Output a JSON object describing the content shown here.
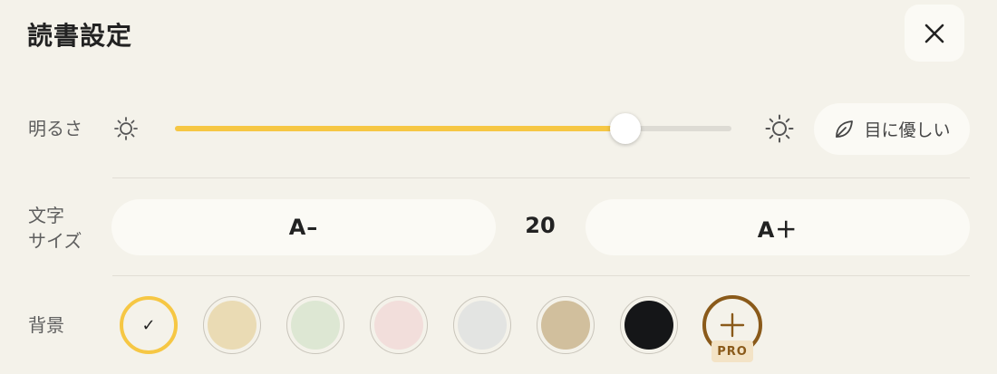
{
  "header": {
    "title": "読書設定",
    "close_icon": "close-icon"
  },
  "brightness": {
    "label": "明るさ",
    "level": 0.81,
    "low_icon": "sun-small-icon",
    "high_icon": "sun-large-icon",
    "accent_color": "#f6c744",
    "eye_friendly_label": "目に優しい",
    "eye_friendly_icon": "leaf-icon"
  },
  "font_size": {
    "label_line1": "文字",
    "label_line2": "サイズ",
    "decrease_label": "A–",
    "value": "20",
    "increase_label": "A＋"
  },
  "background": {
    "label": "背景",
    "selected_index": 0,
    "swatches": [
      {
        "name": "default",
        "color": "#f4f2ea",
        "selected": true,
        "check_icon": "check-icon",
        "check": "✓"
      },
      {
        "name": "beige",
        "color": "#eadbb4",
        "selected": false
      },
      {
        "name": "green",
        "color": "#dde7d3",
        "selected": false
      },
      {
        "name": "pink",
        "color": "#f2dedb",
        "selected": false
      },
      {
        "name": "gray",
        "color": "#e3e4e2",
        "selected": false
      },
      {
        "name": "tan",
        "color": "#d1bf9d",
        "selected": false
      },
      {
        "name": "black",
        "color": "#151618",
        "selected": false
      }
    ],
    "custom": {
      "icon": "plus-icon",
      "badge": "PRO",
      "color": "#8a5a1a"
    }
  }
}
